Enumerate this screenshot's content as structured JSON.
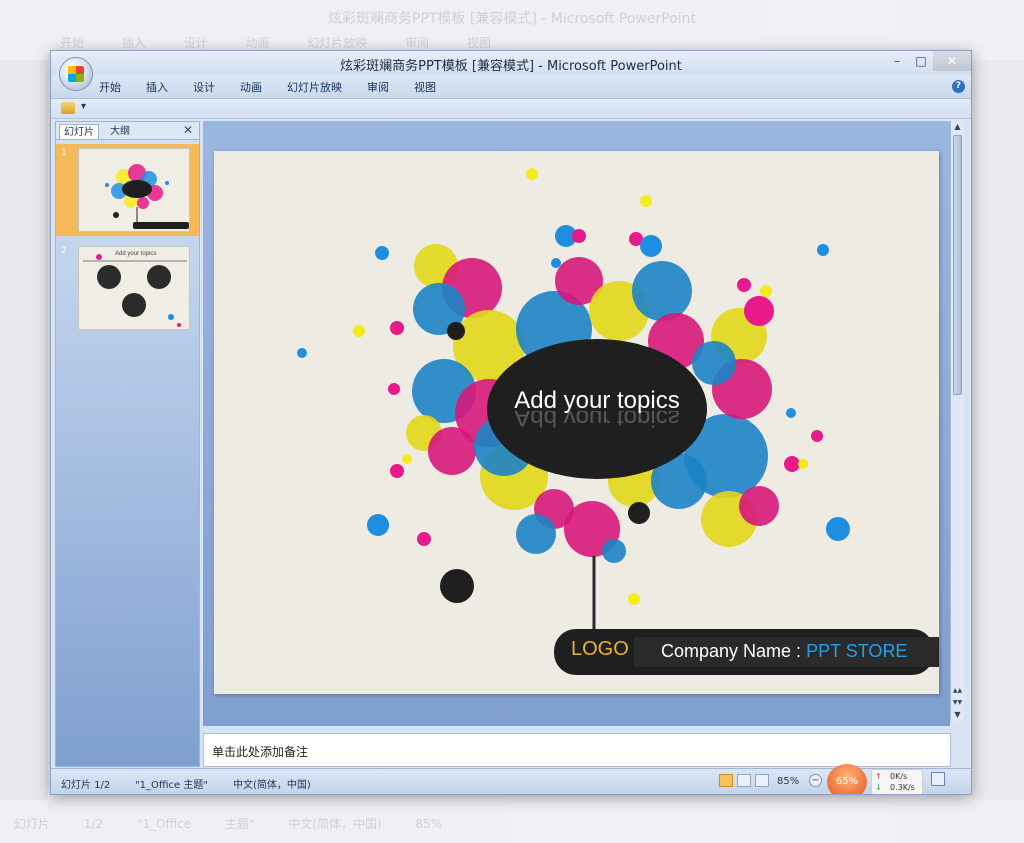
{
  "window": {
    "title": "炫彩斑斓商务PPT模板 [兼容模式] - Microsoft PowerPoint",
    "controls": {
      "minimize": "–",
      "restore": "□",
      "close": "✕"
    }
  },
  "ribbon": {
    "tabs": [
      "开始",
      "插入",
      "设计",
      "动画",
      "幻灯片放映",
      "审阅",
      "视图"
    ],
    "help": "?"
  },
  "qat": {
    "customize": "▾"
  },
  "slides_panel": {
    "tab_slides": "幻灯片",
    "tab_outline": "大纲",
    "close": "✕",
    "thumbnails": [
      {
        "number": "1",
        "selected": true
      },
      {
        "number": "2",
        "selected": false
      }
    ],
    "thumb2_caption": "Add your topics"
  },
  "slide": {
    "topic": "Add your topics",
    "logo": "LOGO",
    "company_label": "Company Name :",
    "company_name": "PPT STORE",
    "colors": {
      "cyan": "#1e8fe0",
      "magenta": "#e8198b",
      "yellow": "#f4ea1c",
      "black": "#1f1f1f",
      "background": "#eeebe2"
    }
  },
  "scroll": {
    "up": "▲",
    "down": "▼",
    "page_up": "▲▲",
    "page_down": "▼▼"
  },
  "notes": {
    "placeholder": "单击此处添加备注"
  },
  "status": {
    "slide": "幻灯片 1/2",
    "theme": "\"1_Office 主题\"",
    "language": "中文(简体，中国)",
    "zoom": "85%",
    "zoom_minus": "−",
    "gauge": "65%",
    "net_up": "0K/s",
    "net_down": "0.3K/s",
    "net_up_icon": "↑",
    "net_down_icon": "↓"
  },
  "background": {
    "title": "炫彩斑斓商务PPT模板 [兼容模式] - Microsoft PowerPoint",
    "ribbon": "开始 插入 设计 动画 幻灯片放映 审阅 视图",
    "status": "幻灯片 1/2 \"1_Office 主题\" 中文(简体，中国) 85%"
  }
}
